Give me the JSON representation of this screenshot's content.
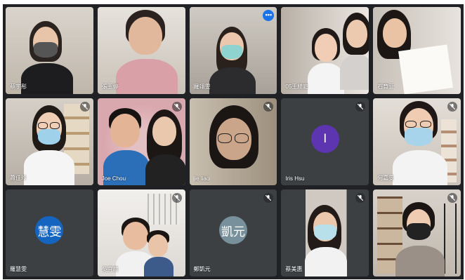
{
  "participants": [
    {
      "name": "蔡宇彤",
      "mic_off": false
    },
    {
      "name": "張玉婷",
      "mic_off": false
    },
    {
      "name": "羅翊雯",
      "mic_off": false,
      "more": "•••"
    },
    {
      "name": "05王綺庭",
      "mic_off": false
    },
    {
      "name": "石育萱",
      "mic_off": false
    },
    {
      "name": "蕭佳玲",
      "mic_off": true
    },
    {
      "name": "Joe Chou",
      "mic_off": true
    },
    {
      "name": "jie liao",
      "mic_off": true
    },
    {
      "name": "Iris Hsu",
      "mic_off": true,
      "avatar": "I",
      "avatar_color": "#5e35b1"
    },
    {
      "name": "何嘉雯",
      "mic_off": true
    },
    {
      "name": "羅慧雯",
      "mic_off": false,
      "avatar": "慧雯",
      "avatar_color": "#1565c0"
    },
    {
      "name": "吳宜庭",
      "mic_off": true
    },
    {
      "name": "鄭凱元",
      "mic_off": true,
      "avatar": "凱元",
      "avatar_color": "#78909c"
    },
    {
      "name": "蔡美惠",
      "mic_off": true
    },
    {
      "name": "",
      "mic_off": true
    }
  ],
  "colors": {
    "stage": "#202124",
    "tile": "#3c4043",
    "accent": "#1a73e8"
  }
}
